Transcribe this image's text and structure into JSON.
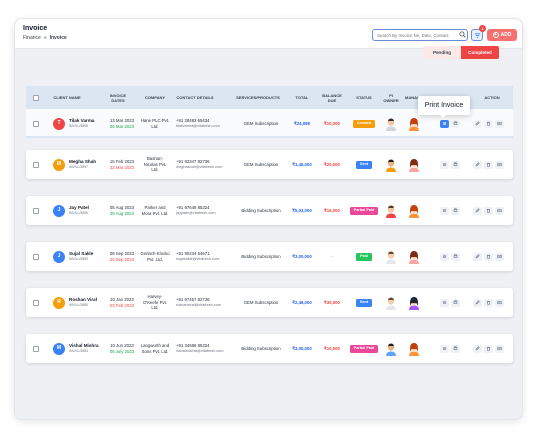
{
  "header": {
    "title": "Invoice",
    "breadcrumb": [
      "Finance",
      "»",
      "Invoice"
    ],
    "search_placeholder": "Search By Invoice No, Date, Contact",
    "filter_count": "1",
    "add_label": "ADD"
  },
  "tabs": {
    "pending": "Pending",
    "completed": "Completed"
  },
  "columns": [
    "CLIENT NAME",
    "INVOICE DATES",
    "COMPANY",
    "CONTACT DETAILS",
    "SERVICES/PRODUCTS",
    "TOTAL",
    "BALANCE DUE",
    "STATUS",
    "PI OWNER",
    "MANAGER",
    "ACTION"
  ],
  "tooltip": "Print Invoice",
  "colors": {
    "accent": "#ef4444",
    "primary": "#3b82f6",
    "header_bg": "#dbe6f2"
  },
  "rows": [
    {
      "initial": "T",
      "avatar_color": "#ef4444",
      "name": "Tilak Varma",
      "id": "INV/LL/3898",
      "date": "13 Mar 2023",
      "due": "26 Mar 2023",
      "due_overdue": false,
      "company": "Hane PLC Pvt. Ltd.",
      "phone": "+91 28482 65434",
      "email": "tilakvarma@vitafresh.com",
      "service": "GEM Subscription",
      "total": "₹24,098",
      "balance": "₹10,000",
      "status": "Created",
      "status_color": "#f59e0b",
      "owner": "man-1",
      "manager": "woman-1"
    },
    {
      "initial": "M",
      "avatar_color": "#f59e0b",
      "name": "Megha Shah",
      "id": "INV/LL/3897",
      "date": "15 Feb 2023",
      "due": "22 Mar 2023",
      "due_overdue": true,
      "company": "Bashan-Nicolas Pvt. Ltd.",
      "phone": "+91 92347 82736",
      "email": "meghashah@vitafresh.com",
      "service": "GEM Subscription",
      "total": "₹1,46,000",
      "balance": "₹20,000",
      "status": "Sent",
      "status_color": "#3b82f6",
      "owner": "man-2",
      "manager": "woman-2"
    },
    {
      "initial": "J",
      "avatar_color": "#3b82f6",
      "name": "Jay Patel",
      "id": "INV/LL/3896",
      "date": "05 Aug 2023",
      "due": "25 Aug 2023",
      "due_overdue": false,
      "company": "Parker and Mora Pvt. Ltd.",
      "phone": "+91 97648 85324",
      "email": "jaypatel@vitafresh.com",
      "service": "Bidding Subscription",
      "total": "₹5,03,000",
      "balance": "₹15,000",
      "status": "Partial Paid",
      "status_color": "#ec4899",
      "owner": "man-3",
      "manager": "woman-1"
    },
    {
      "initial": "J",
      "avatar_color": "#3b82f6",
      "name": "Sujal Sakle",
      "id": "INV/LL/3895",
      "date": "08 Sep 2023",
      "due": "20 Sep 2023",
      "due_overdue": true,
      "company": "Gerlach-Klocko Pvt. Ltd.",
      "phone": "+91 90234 54671",
      "email": "sujalsakle@vitafresh.com",
      "service": "Bidding Subscription",
      "total": "₹3,00,000",
      "balance": "-",
      "status": "Paid",
      "status_color": "#22c55e",
      "owner": "man-4",
      "manager": "woman-2"
    },
    {
      "initial": "R",
      "avatar_color": "#f59e0b",
      "name": "Roshan Viral",
      "id": "INV/LL/3880",
      "date": "20 Jan 2023",
      "due": "03 Feb 2023",
      "due_overdue": true,
      "company": "Harvey-O'Keefe Pvt. Ltd.",
      "phone": "+91 97457 82736",
      "email": "roshanviral@vitafresh.com",
      "service": "GEM Subscription",
      "total": "₹2,46,000",
      "balance": "₹30,000",
      "status": "Sent",
      "status_color": "#3b82f6",
      "owner": "man-4",
      "manager": "woman-3"
    },
    {
      "initial": "M",
      "avatar_color": "#3b82f6",
      "name": "Vishal Mishra",
      "id": "INV/LL/3884",
      "date": "10 Jun 2023",
      "due": "05 July 2023",
      "due_overdue": false,
      "company": "Langworth and Sons Pvt. Ltd.",
      "phone": "+91 34686 85324",
      "email": "vishalmishra@vitafresh.com",
      "service": "Bidding Subscription",
      "total": "₹3,00,000",
      "balance": "₹10,000",
      "status": "Partial Paid",
      "status_color": "#ec4899",
      "owner": "man-5",
      "manager": "woman-1"
    }
  ]
}
